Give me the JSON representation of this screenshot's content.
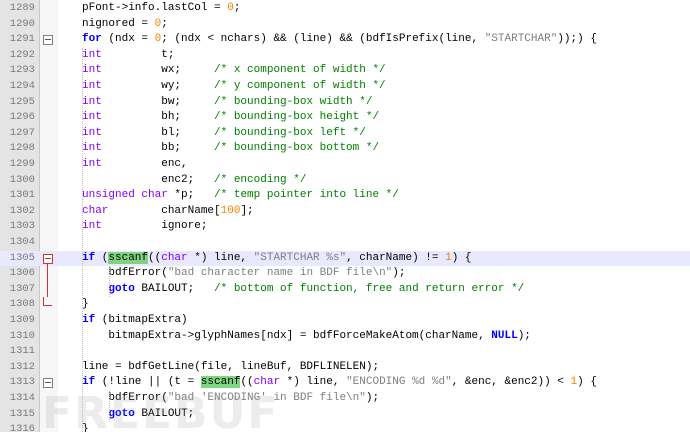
{
  "editor": {
    "lines": [
      {
        "no": "1289",
        "html": "pFont-&gt;info.lastCol = <span class='n'>0</span>;"
      },
      {
        "no": "1290",
        "html": "nignored = <span class='n'>0</span>;"
      },
      {
        "no": "1291",
        "fold": "open",
        "html": "<span class='k'>for</span> (ndx = <span class='n'>0</span>; (ndx &lt; nchars) &amp;&amp; (line) &amp;&amp; (bdfIsPrefix(line, <span class='s'>\"STARTCHAR\"</span>));) {"
      },
      {
        "no": "1292",
        "html": "<span class='t'>int</span>         t;"
      },
      {
        "no": "1293",
        "html": "<span class='t'>int</span>         wx;     <span class='c'>/* x component of width */</span>"
      },
      {
        "no": "1294",
        "html": "<span class='t'>int</span>         wy;     <span class='c'>/* y component of width */</span>"
      },
      {
        "no": "1295",
        "html": "<span class='t'>int</span>         bw;     <span class='c'>/* bounding-box width */</span>"
      },
      {
        "no": "1296",
        "html": "<span class='t'>int</span>         bh;     <span class='c'>/* bounding-box height */</span>"
      },
      {
        "no": "1297",
        "html": "<span class='t'>int</span>         bl;     <span class='c'>/* bounding-box left */</span>"
      },
      {
        "no": "1298",
        "html": "<span class='t'>int</span>         bb;     <span class='c'>/* bounding-box bottom */</span>"
      },
      {
        "no": "1299",
        "html": "<span class='t'>int</span>         enc,"
      },
      {
        "no": "1300",
        "html": "            enc2;   <span class='c'>/* encoding */</span>"
      },
      {
        "no": "1301",
        "html": "<span class='t'>unsigned char</span> *p;   <span class='c'>/* temp pointer into line */</span>"
      },
      {
        "no": "1302",
        "html": "<span class='t'>char</span>        charName[<span class='n'>100</span>];"
      },
      {
        "no": "1303",
        "html": "<span class='t'>int</span>         ignore;"
      },
      {
        "no": "1304",
        "html": ""
      },
      {
        "no": "1305",
        "fold": "open-red",
        "hl": true,
        "html": "<span class='k'>if</span> (<span class='f'>sscanf</span>((<span class='t'>char</span> *) line, <span class='s'>\"STARTCHAR %s\"</span>, charName) != <span class='n'>1</span>) {"
      },
      {
        "no": "1306",
        "html": "    bdfError(<span class='s'>\"bad character name in BDF file\\n\"</span>);"
      },
      {
        "no": "1307",
        "html": "    <span class='k'>goto</span> BAILOUT;   <span class='c'>/* bottom of function, free and return error */</span>"
      },
      {
        "no": "1308",
        "fold": "end",
        "html": "}"
      },
      {
        "no": "1309",
        "html": "<span class='k'>if</span> (bitmapExtra)"
      },
      {
        "no": "1310",
        "html": "    bitmapExtra-&gt;glyphNames[ndx] = bdfForceMakeAtom(charName, <span class='k'>NULL</span>);"
      },
      {
        "no": "1311",
        "html": ""
      },
      {
        "no": "1312",
        "html": "line = bdfGetLine(file, lineBuf, BDFLINELEN);"
      },
      {
        "no": "1313",
        "fold": "open",
        "html": "<span class='k'>if</span> (!line || (t = <span class='f'>sscanf</span>((<span class='t'>char</span> *) line, <span class='s'>\"ENCODING %d %d\"</span>, &amp;enc, &amp;enc2)) &lt; <span class='n'>1</span>) {"
      },
      {
        "no": "1314",
        "html": "    bdfError(<span class='s'>\"bad 'ENCODING' in BDF file\\n\"</span>);"
      },
      {
        "no": "1315",
        "html": "    <span class='k'>goto</span> BAILOUT;"
      },
      {
        "no": "1316",
        "html": "}"
      }
    ]
  },
  "watermark": "FREEBUF",
  "colors": {
    "gutter_bg": "#e4e4e4",
    "highlight_line": "#e8e8ff",
    "keyword": "#0000ff",
    "type": "#8000ff",
    "number": "#ff8000",
    "string": "#808080",
    "comment": "#008000",
    "match_highlight": "#7fd47f"
  }
}
